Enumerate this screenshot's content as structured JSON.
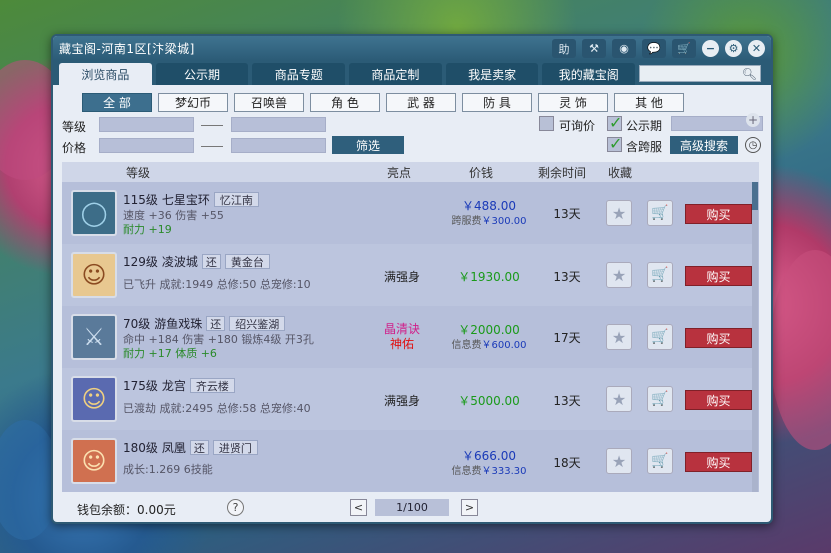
{
  "window": {
    "title": "藏宝阁-河南1区[汴梁城]",
    "help_label": "助"
  },
  "tabs": [
    {
      "label": "浏览商品",
      "active": true
    },
    {
      "label": "公示期"
    },
    {
      "label": "商品专题"
    },
    {
      "label": "商品定制"
    },
    {
      "label": "我是卖家"
    },
    {
      "label": "我的藏宝阁"
    }
  ],
  "categories": [
    "全 部",
    "梦幻币",
    "召唤兽",
    "角 色",
    "武 器",
    "防 具",
    "灵 饰",
    "其 他"
  ],
  "filters": {
    "level_label": "等级",
    "price_label": "价格",
    "filter_button": "筛选",
    "negotiable_label": "可询价",
    "public_label": "公示期",
    "cross_server_label": "含跨服",
    "advanced_button": "高级搜索"
  },
  "columns": {
    "level": "等级",
    "highlight": "亮点",
    "price": "价钱",
    "time_left": "剩余时间",
    "favorite": "收藏"
  },
  "buy_label": "购买",
  "items": [
    {
      "level": "115级",
      "name": "七星宝环",
      "server": "忆江南",
      "stat1": "速度 +36 伤害 +55",
      "stat2_label": "耐力",
      "stat2_value": "+19",
      "highlight": "",
      "price": "￥488.00",
      "fee_label": "跨服费",
      "fee_value": "￥300.00",
      "time_left": "13天"
    },
    {
      "level": "129级",
      "name": "凌波城",
      "tag": "还",
      "server": "黄金台",
      "stat1": "已飞升 成就:1949 总修:50 总宠修:10",
      "highlight": "满强身",
      "price": "￥1930.00",
      "time_left": "13天"
    },
    {
      "level": "70级",
      "name": "游鱼戏珠",
      "tag": "还",
      "server": "绍兴鉴湖",
      "stat1": "命中 +184 伤害 +180 锻炼4级 开3孔",
      "stat2_label": "耐力",
      "stat2_value": "+17 体质 +6",
      "highlight_a": "晶清诀",
      "highlight_b": "神佑",
      "price": "￥2000.00",
      "fee_label": "信息费",
      "fee_value": "￥600.00",
      "time_left": "17天"
    },
    {
      "level": "175级",
      "name": "龙宫",
      "server": "齐云楼",
      "stat1": "已渡劫 成就:2495 总修:58 总宠修:40",
      "highlight": "满强身",
      "price": "￥5000.00",
      "time_left": "13天"
    },
    {
      "level": "180级",
      "name": "凤凰",
      "tag": "还",
      "server": "进贤门",
      "stat1": "成长:1.269 6技能",
      "price": "￥666.00",
      "fee_label": "信息费",
      "fee_value": "￥333.30",
      "time_left": "18天"
    }
  ],
  "footer": {
    "wallet_label": "钱包余额：",
    "wallet_value": "0.00元",
    "help": "?",
    "page": "1/100"
  }
}
